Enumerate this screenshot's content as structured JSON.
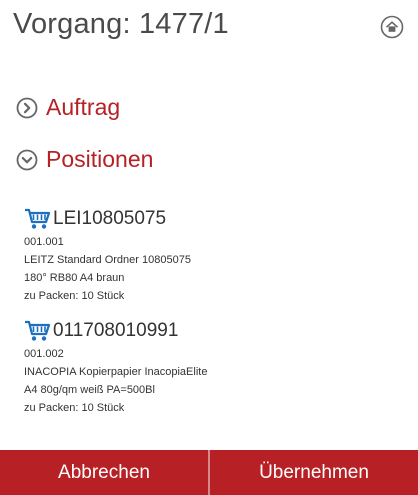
{
  "header": {
    "title": "Vorgang: 1477/1",
    "home_icon": "home-icon"
  },
  "sections": {
    "auftrag": {
      "label": "Auftrag",
      "state": "collapsed",
      "icon": "chevron-right-icon"
    },
    "positionen": {
      "label": "Positionen",
      "state": "expanded",
      "icon": "chevron-down-icon"
    }
  },
  "positions": [
    {
      "icon": "cart-icon",
      "code": "LEI10805075",
      "number": "001.001",
      "desc1": "LEITZ Standard Ordner 10805075",
      "desc2": "180° RB80 A4 braun",
      "pack": "zu Packen: 10 Stück"
    },
    {
      "icon": "cart-icon",
      "code": "011708010991",
      "number": "001.002",
      "desc1": "INACOPIA Kopierpapier InacopiaElite",
      "desc2": "A4 80g/qm weiß PA=500Bl",
      "pack": "zu Packen: 10 Stück"
    }
  ],
  "footer": {
    "cancel_label": "Abbrechen",
    "confirm_label": "Übernehmen"
  },
  "colors": {
    "accent": "#b72025",
    "icon_blue": "#1f6fc0",
    "text": "#333333",
    "icon_grey": "#666666"
  }
}
